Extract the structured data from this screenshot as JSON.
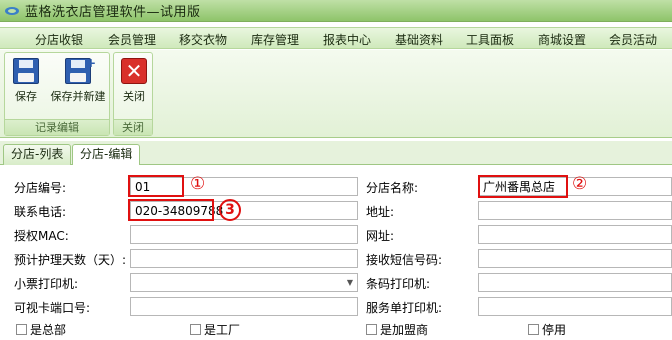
{
  "window": {
    "title": "蓝格洗衣店管理软件—试用版"
  },
  "menu": [
    "分店收银",
    "会员管理",
    "移交衣物",
    "库存管理",
    "报表中心",
    "基础资料",
    "工具面板",
    "商城设置",
    "会员活动"
  ],
  "ribbon": {
    "save": "保存",
    "save_new": "保存并新建",
    "close": "关闭",
    "group_edit": "记录编辑",
    "group_close": "关闭"
  },
  "tabs": {
    "list": "分店-列表",
    "edit": "分店-编辑"
  },
  "form": {
    "store_code_label": "分店编号:",
    "store_code_value": "01",
    "store_name_label": "分店名称:",
    "store_name_value": "广州番禺总店",
    "phone_label": "联系电话:",
    "phone_value": "020-34809788",
    "address_label": "地址:",
    "mac_label": "授权MAC:",
    "website_label": "网址:",
    "days_label": "预计护理天数（天）:",
    "sms_label": "接收短信号码:",
    "receipt_printer_label": "小票打印机:",
    "barcode_printer_label": "条码打印机:",
    "card_port_label": "可视卡端口号:",
    "service_printer_label": "服务单打印机:",
    "chk_headquarters": "是总部",
    "chk_factory": "是工厂",
    "chk_franchise": "是加盟商",
    "chk_disabled": "停用"
  },
  "annotations": {
    "one": "①",
    "two": "②",
    "three": "3"
  },
  "colors": {
    "title_bar": "#8ec46a",
    "marker": "#e01010"
  }
}
